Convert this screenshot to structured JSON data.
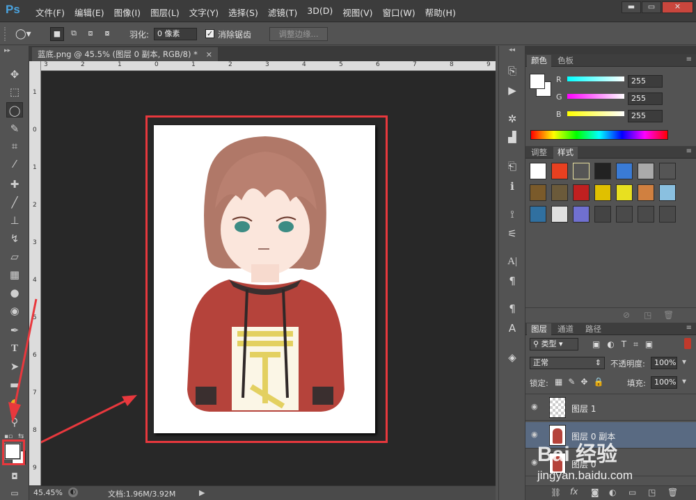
{
  "app": {
    "logo": "Ps"
  },
  "menu": [
    "文件(F)",
    "编辑(E)",
    "图像(I)",
    "图层(L)",
    "文字(Y)",
    "选择(S)",
    "滤镜(T)",
    "3D(D)",
    "视图(V)",
    "窗口(W)",
    "帮助(H)"
  ],
  "window_controls": {
    "minimize": "▬",
    "maximize": "▭",
    "close": "✕"
  },
  "options": {
    "feather_label": "羽化:",
    "feather_value": "0 像素",
    "antialias_label": "消除锯齿",
    "antialias_checked": true,
    "refine_edge": "调整边缘..."
  },
  "document": {
    "tab_title": "蓝底.png @ 45.5% (图层 0 副本, RGB/8) *",
    "close": "×"
  },
  "ruler": {
    "top_ticks": [
      "3",
      "2",
      "1",
      "0",
      "1",
      "2",
      "3",
      "4",
      "5",
      "6",
      "7",
      "8",
      "9"
    ],
    "left_ticks": [
      "1",
      "0",
      "1",
      "2",
      "3",
      "4",
      "5",
      "6",
      "7",
      "8",
      "9"
    ]
  },
  "status": {
    "zoom": "45.45%",
    "doc_info": "文档:1.96M/3.92M"
  },
  "color_panel": {
    "tabs": [
      "颜色",
      "色板"
    ],
    "channels": [
      {
        "label": "R",
        "value": "255"
      },
      {
        "label": "G",
        "value": "255"
      },
      {
        "label": "B",
        "value": "255"
      }
    ],
    "foreground": "#ffffff",
    "background": "#ffffff"
  },
  "styles_panel": {
    "tabs": [
      "调整",
      "样式"
    ]
  },
  "layers_panel": {
    "tabs": [
      "图层",
      "通道",
      "路径"
    ],
    "filter_kind": "类型",
    "blend_mode": "正常",
    "opacity_label": "不透明度:",
    "opacity_value": "100%",
    "lock_label": "锁定:",
    "fill_label": "填充:",
    "fill_value": "100%",
    "layers": [
      {
        "name": "图层 1",
        "selected": false
      },
      {
        "name": "图层 0 副本",
        "selected": true
      },
      {
        "name": "图层 0",
        "selected": false
      }
    ]
  },
  "watermark": {
    "text": "Bai 经验",
    "url": "jingyan.baidu.com"
  },
  "colors": {
    "highlight_red": "#e8383d",
    "accent_blue": "#4aa3df"
  }
}
